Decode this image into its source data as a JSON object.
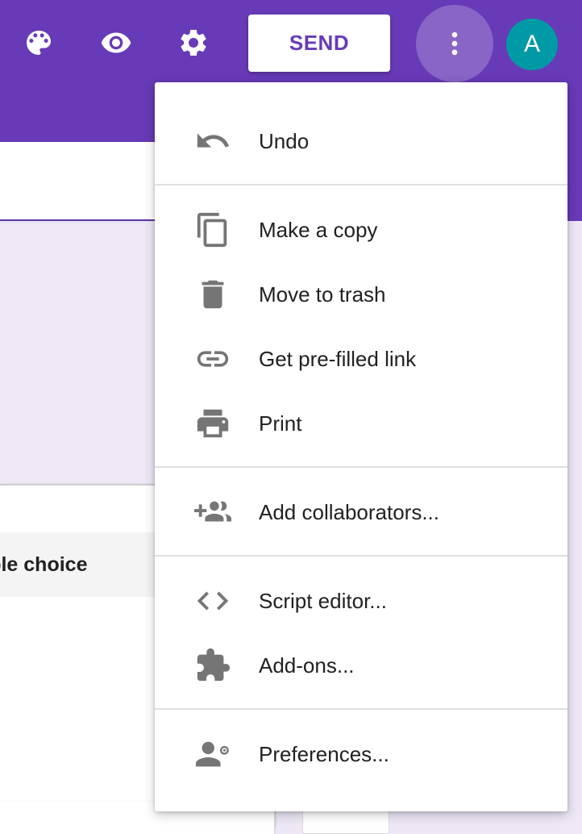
{
  "toolbar": {
    "palette_icon": "palette-icon",
    "preview_icon": "eye-icon",
    "settings_icon": "gear-icon",
    "send_label": "SEND",
    "more_icon": "more-vert-icon",
    "avatar_letter": "A",
    "colors": {
      "bar": "#673ab7",
      "avatar": "#009aa6"
    }
  },
  "background": {
    "question_type": "ltiple choice"
  },
  "menu": {
    "items": [
      {
        "label": "Undo",
        "icon": "undo-icon"
      },
      {
        "label": "Make a copy",
        "icon": "copy-icon"
      },
      {
        "label": "Move to trash",
        "icon": "trash-icon"
      },
      {
        "label": "Get pre-filled link",
        "icon": "link-icon"
      },
      {
        "label": "Print",
        "icon": "print-icon"
      },
      {
        "label": "Add collaborators...",
        "icon": "add-people-icon"
      },
      {
        "label": "Script editor...",
        "icon": "code-icon"
      },
      {
        "label": "Add-ons...",
        "icon": "puzzle-icon"
      },
      {
        "label": "Preferences...",
        "icon": "person-settings-icon"
      }
    ]
  }
}
